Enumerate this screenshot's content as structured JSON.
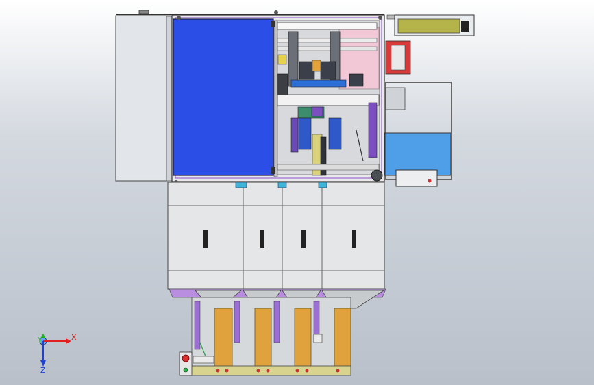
{
  "viewport": {
    "background_top": "#ffffff",
    "background_bottom": "#b9c0ca"
  },
  "triad": {
    "x_label": "X",
    "y_label": "Y",
    "z_label": "Z",
    "x_color": "#e02020",
    "y_color": "#20b020",
    "z_color": "#2040d0"
  },
  "colors": {
    "door_blue": "#2b4fe6",
    "cabinet_grey": "#e4e6e8",
    "hopper_orange": "#e0a23c",
    "frame_purple": "#8a4fc0",
    "base_olive": "#d8d490",
    "panel_light_blue": "#4f9ee8"
  }
}
